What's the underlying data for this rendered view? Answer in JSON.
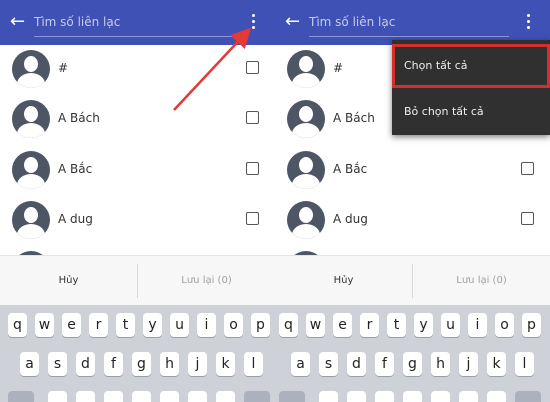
{
  "theme": {
    "primary": "#3f51b5",
    "menu_bg": "#303030",
    "highlight": "#d32f2f",
    "arrow": "#e53935"
  },
  "search": {
    "placeholder": "Tìm số liên lạc"
  },
  "contacts": [
    "#",
    "A Bách",
    "A Bắc",
    "A dug"
  ],
  "actions": {
    "cancel": "Hủy",
    "save": "Lưu lại (0)"
  },
  "keyboard": {
    "row1": [
      "q",
      "w",
      "e",
      "r",
      "t",
      "y",
      "u",
      "i",
      "o",
      "p"
    ],
    "row2": [
      "a",
      "s",
      "d",
      "f",
      "g",
      "h",
      "j",
      "k",
      "l"
    ]
  },
  "menu": {
    "select_all": "Chọn tất cả",
    "deselect_all": "Bỏ chọn tất cả"
  }
}
